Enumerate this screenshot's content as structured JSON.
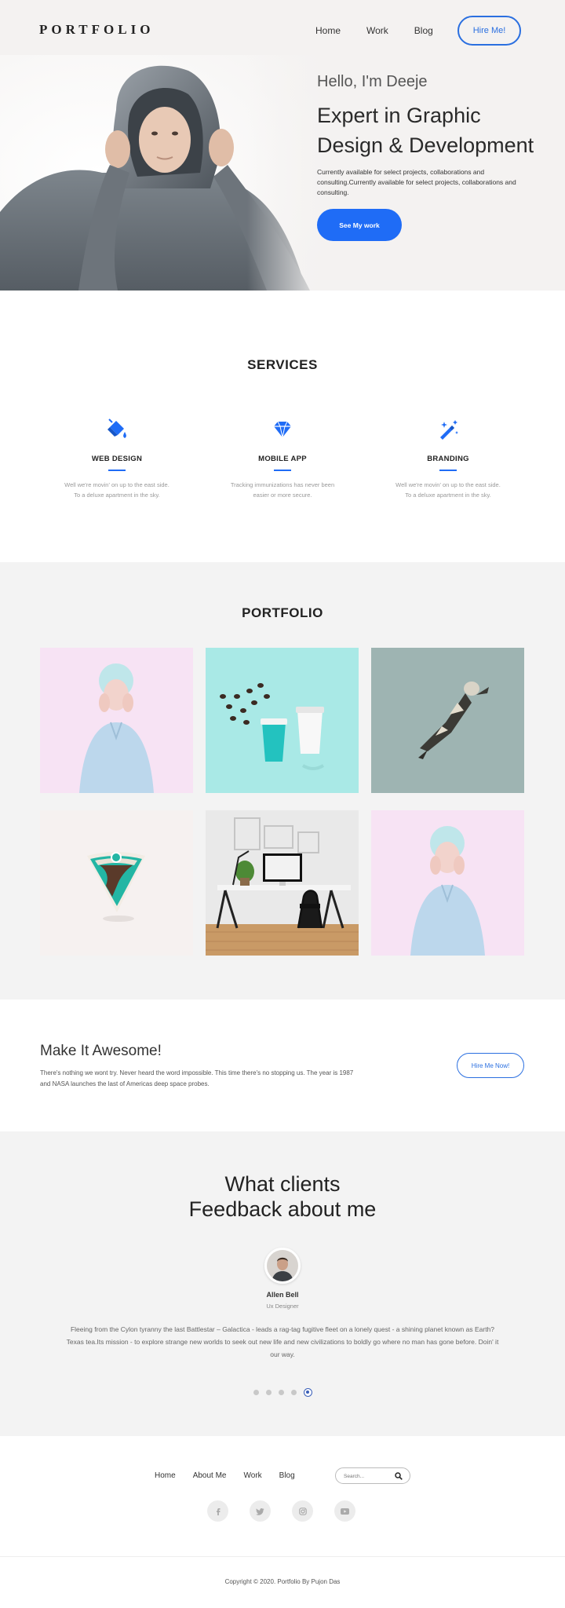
{
  "header": {
    "logo": "PORTFOLIO",
    "nav": [
      "Home",
      "Work",
      "Blog"
    ],
    "hire_label": "Hire Me!"
  },
  "hero": {
    "greeting": "Hello, I'm Deeje",
    "headline": "Expert in Graphic Design & Development",
    "description": "Currently available for select projects, collaborations and consulting.Currently available for select projects, collaborations and consulting.",
    "cta_label": "See My work"
  },
  "services": {
    "title": "SERVICES",
    "items": [
      {
        "title": "WEB DESIGN",
        "desc": "Well we're movin' on up to the east side. To a deluxe apartment in the sky.",
        "icon": "paint-bucket-icon"
      },
      {
        "title": "MOBILE APP",
        "desc": "Tracking immunizations has never been easier or more secure.",
        "icon": "diamond-icon"
      },
      {
        "title": "BRANDING",
        "desc": "Well we're movin' on up to the east side. To a deluxe apartment in the sky.",
        "icon": "magic-wand-icon"
      }
    ]
  },
  "portfolio": {
    "title": "PORTFOLIO"
  },
  "cta": {
    "title": "Make It Awesome!",
    "desc": "There's nothing we wont try. Never heard the word impossible. This time there's no stopping us. The year is 1987 and NASA launches the last of Americas deep space probes.",
    "button": "Hire Me Now!"
  },
  "testimonials": {
    "title_line1": "What clients",
    "title_line2": "Feedback about me",
    "name": "Allen Bell",
    "role": "Ux Designer",
    "quote": "Fleeing from the Cylon tyranny the last Battlestar – Galactica - leads a rag-tag fugitive fleet on a lonely quest - a shining planet known as Earth? Texas tea.Its mission - to explore strange new worlds to seek out new life and new civilizations to boldly go where no man has gone before. Doin' it our way.",
    "active_slide": 5,
    "slide_count": 5
  },
  "footer": {
    "nav": [
      "Home",
      "About Me",
      "Work",
      "Blog"
    ],
    "search_placeholder": "Search...",
    "socials": [
      "facebook-icon",
      "twitter-icon",
      "instagram-icon",
      "youtube-icon"
    ],
    "copyright": "Copyright © 2020. Portfolio By Pujon Das"
  },
  "colors": {
    "accent": "#1f6cf6",
    "hero_bg": "#f4f2f1",
    "section_bg": "#f3f3f3"
  }
}
